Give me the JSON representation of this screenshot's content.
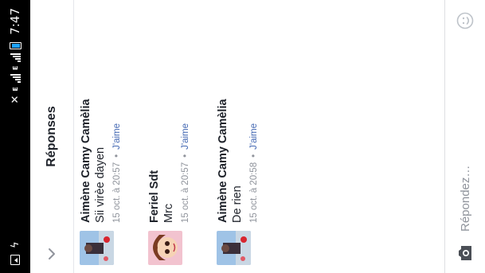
{
  "status_bar": {
    "network_type": "E",
    "time": "7:47"
  },
  "header": {
    "title": "Réponses",
    "back_icon": "chevron-down-icon"
  },
  "replies": [
    {
      "author": "Aimène Camy Camèlia",
      "text": "Sii virèe dayen",
      "date": "15 oct. à 20:57",
      "like_label": "J'aime"
    },
    {
      "author": "Feriel Sdt",
      "text": "Mrc",
      "date": "15 oct. à 20:57",
      "like_label": "J'aime"
    },
    {
      "author": "Aimène Camy Camèlia",
      "text": "De rien",
      "date": "15 oct. à 20:58",
      "like_label": "J'aime"
    }
  ],
  "composer": {
    "placeholder": "Répondez…",
    "camera_icon": "camera-icon",
    "emoji_icon": "emoji-icon"
  },
  "colors": {
    "link": "#4267b2",
    "meta": "#90949c",
    "text": "#1d2129",
    "statusbar": "#000000",
    "battery": "#1fa3ff"
  }
}
